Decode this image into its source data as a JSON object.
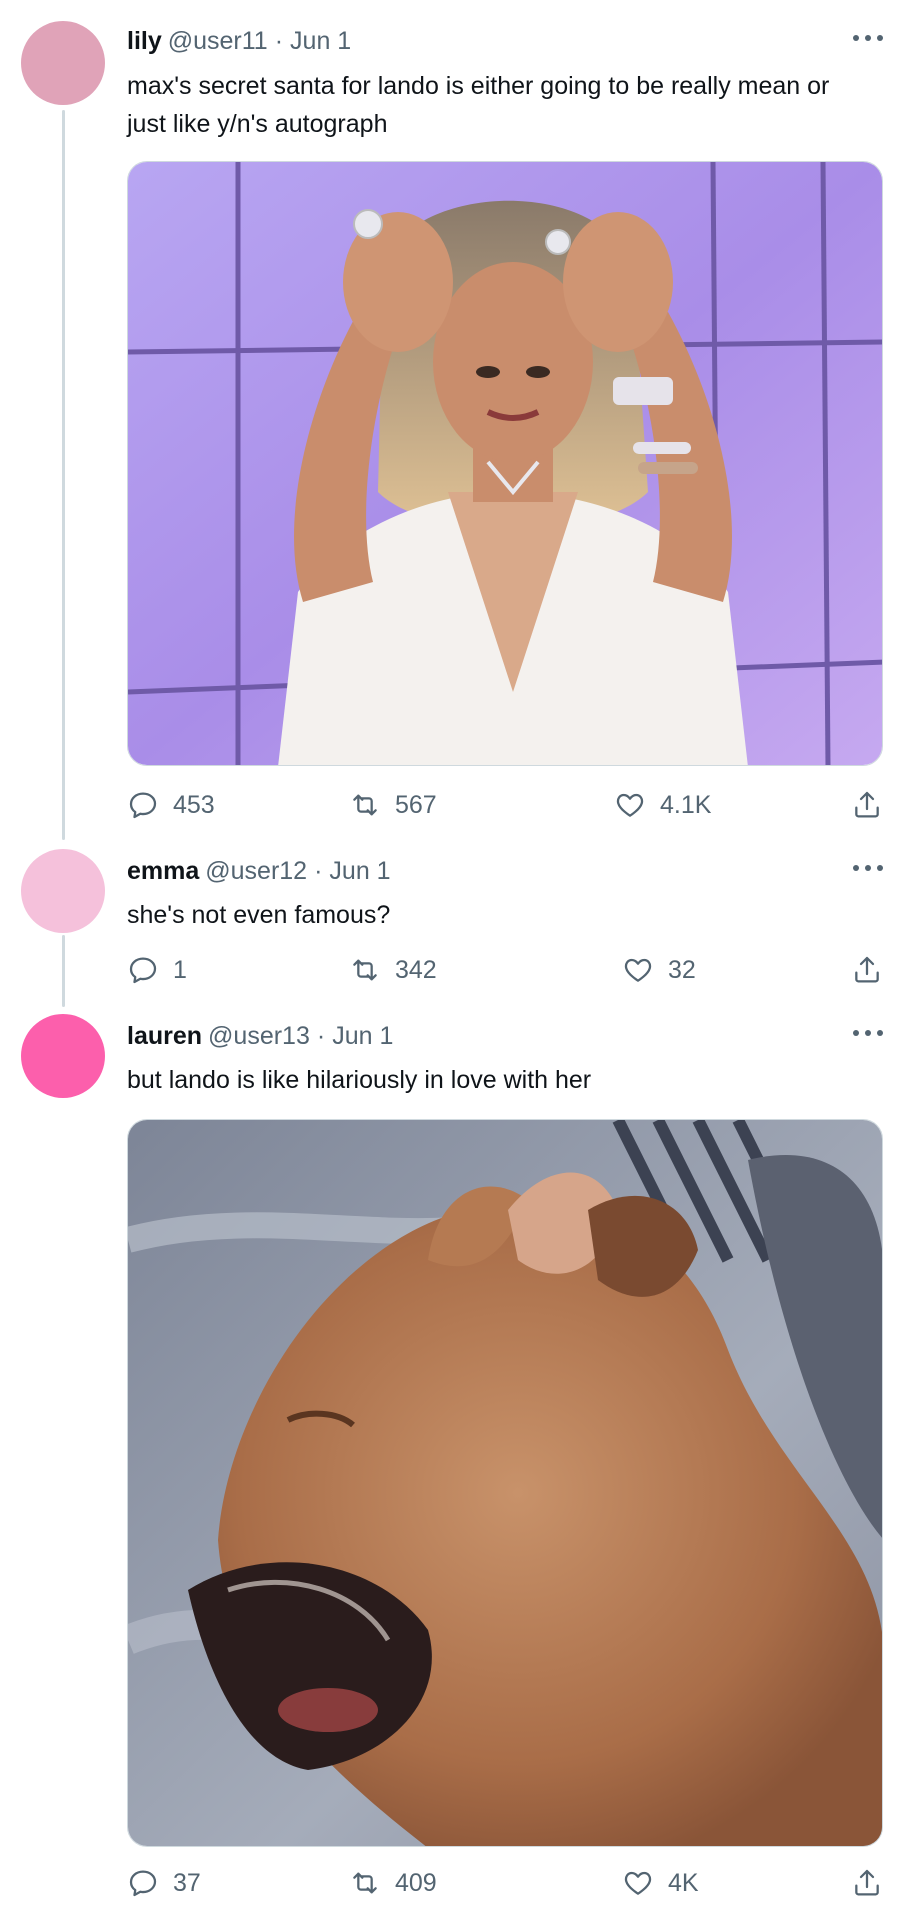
{
  "tweets": [
    {
      "name": "lily",
      "handle": "@user11",
      "dot": "·",
      "date": "Jun 1",
      "text": "max's secret santa for lando is either going to be really mean or just like y/n's autograph",
      "avatar_color": "#e0a3b8",
      "media": "photo of a woman in a white dress with both hands on her forehead, looking stressed, in front of a purple backdrop",
      "replies": "453",
      "retweets": "567",
      "likes": "4.1K"
    },
    {
      "name": "emma",
      "handle": "@user12",
      "dot": "·",
      "date": "Jun 1",
      "text": "she's not even famous?",
      "avatar_color": "#f5c1db",
      "replies": "1",
      "retweets": "342",
      "likes": "32"
    },
    {
      "name": "lauren",
      "handle": "@user13",
      "dot": "·",
      "date": "Jun 1",
      "text": "but lando is like hilariously in love with her",
      "avatar_color": "#fc5fac",
      "media": "blurry photo of a small brown dog yawning on a grey blanket",
      "replies": "37",
      "retweets": "409",
      "likes": "4K"
    }
  ],
  "icons": {
    "reply": "reply-icon",
    "retweet": "retweet-icon",
    "like": "heart-icon",
    "share": "share-icon",
    "more": "more-icon"
  },
  "colors": {
    "text": "#0f1419",
    "secondary": "#536471",
    "thread_line": "#cfd9de"
  }
}
